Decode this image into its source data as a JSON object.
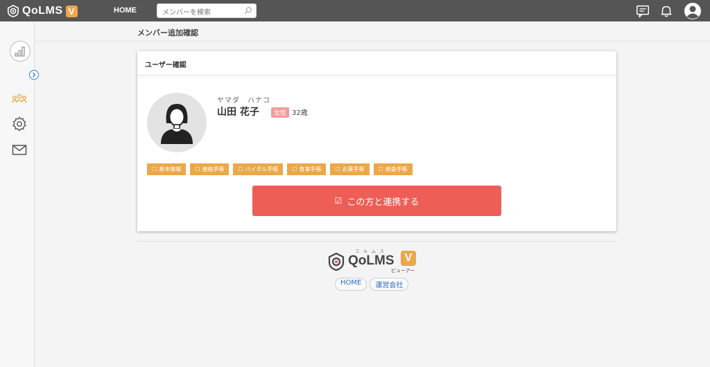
{
  "header": {
    "logo_text": "QoLMS",
    "logo_badge": "V",
    "home_label": "HOME",
    "search_placeholder": "メンバーを検索",
    "icons": [
      "chat-icon",
      "bell-icon",
      "user-account-icon"
    ]
  },
  "sidebar": {
    "items": [
      {
        "name": "dashboard",
        "icon": "bar-chart-icon"
      },
      {
        "name": "expand",
        "icon": "chevron-right-icon"
      },
      {
        "name": "members",
        "icon": "group-icon"
      },
      {
        "name": "settings",
        "icon": "gear-icon"
      },
      {
        "name": "mail",
        "icon": "mail-icon"
      }
    ]
  },
  "page": {
    "title": "メンバー追加確認"
  },
  "card": {
    "title": "ユーザー確認",
    "user": {
      "kana": "ヤマダ　ハナコ",
      "name": "山田 花子",
      "gender": "女性",
      "age": "32歳"
    },
    "tags": [
      "基本情報",
      "連絡手帳",
      "バイタル手帳",
      "食事手帳",
      "お薬手帳",
      "検査手帳"
    ],
    "action_label": "この方と連携する"
  },
  "footer": {
    "logo_text": "QoLMS",
    "logo_ruby": "コ ル ム ス",
    "logo_badge": "V",
    "logo_sub": "ビューアー",
    "links": [
      "HOME",
      "運営会社"
    ]
  },
  "colors": {
    "header_bg": "#555555",
    "accent_orange": "#eba74a",
    "action_red": "#ed5e56",
    "gender_pink": "#f19c9c",
    "link_blue": "#2f6cc7"
  }
}
